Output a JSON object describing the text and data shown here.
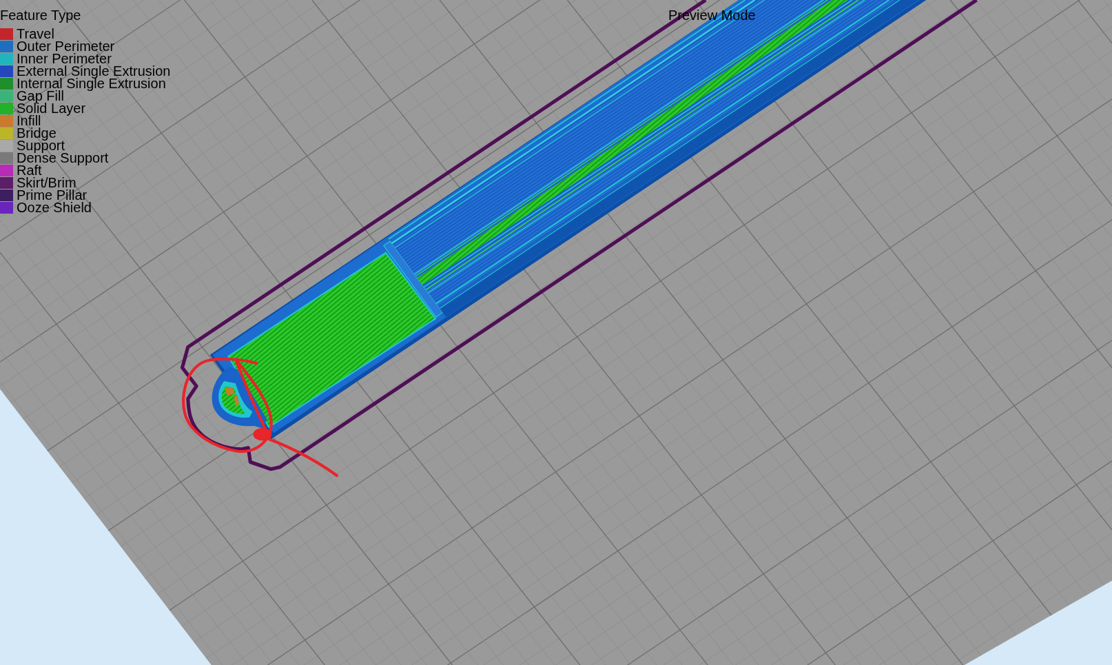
{
  "legend": {
    "title": "Feature Type",
    "items": [
      {
        "label": "Travel",
        "color": "#c4252b"
      },
      {
        "label": "Outer Perimeter",
        "color": "#1f6fc0"
      },
      {
        "label": "Inner Perimeter",
        "color": "#20b5bd"
      },
      {
        "label": "External Single Extrusion",
        "color": "#2447c0"
      },
      {
        "label": "Internal Single Extrusion",
        "color": "#1e8f2a"
      },
      {
        "label": "Gap Fill",
        "color": "#3ab57a"
      },
      {
        "label": "Solid Layer",
        "color": "#22b22a"
      },
      {
        "label": "Infill",
        "color": "#c97a2a"
      },
      {
        "label": "Bridge",
        "color": "#bcb52a"
      },
      {
        "label": "Support",
        "color": "#a9a9a9"
      },
      {
        "label": "Dense Support",
        "color": "#7a7a7a"
      },
      {
        "label": "Raft",
        "color": "#b82ab8"
      },
      {
        "label": "Skirt/Brim",
        "color": "#5a1f66"
      },
      {
        "label": "Prime Pillar",
        "color": "#3b1f5f"
      },
      {
        "label": "Ooze Shield",
        "color": "#6a25bc"
      }
    ]
  },
  "viewport": {
    "mode_label": "Preview Mode"
  }
}
